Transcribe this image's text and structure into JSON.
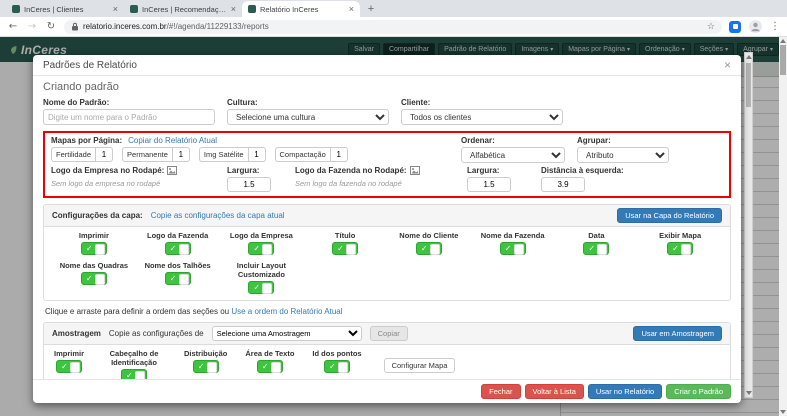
{
  "browser": {
    "tabs": [
      {
        "title": "InCeres | Clientes"
      },
      {
        "title": "InCeres | Recomendação"
      },
      {
        "title": "Relatório InCeres"
      }
    ],
    "url_domain": "relatorio.inceres.com.br",
    "url_path": "/#!/agenda/11229133/reports"
  },
  "app": {
    "logo": "InCeres",
    "nav": [
      {
        "label": "Salvar"
      },
      {
        "label": "Compartilhar"
      },
      {
        "label": "Padrão de Relatório"
      },
      {
        "label": "Imagens"
      },
      {
        "label": "Mapas por Página"
      },
      {
        "label": "Ordenação"
      },
      {
        "label": "Seções"
      },
      {
        "label": "Agrupar"
      }
    ]
  },
  "modal": {
    "title": "Padrões de Relatório",
    "heading": "Criando padrão",
    "form": {
      "nome_label": "Nome do Padrão:",
      "nome_placeholder": "Digite um nome para o Padrão",
      "cultura_label": "Cultura:",
      "cultura_value": "Selecione uma cultura",
      "cliente_label": "Cliente:",
      "cliente_value": "Todos os clientes"
    },
    "mapas": {
      "title": "Mapas por Página:",
      "copy_link": "Copiar do Relatório Atual",
      "fields": [
        {
          "label": "Fertilidade",
          "value": "1"
        },
        {
          "label": "Permanente",
          "value": "1"
        },
        {
          "label": "Img Satélite",
          "value": "1"
        },
        {
          "label": "Compactação",
          "value": "1"
        }
      ],
      "ordenar_label": "Ordenar:",
      "ordenar_value": "Alfabética",
      "agrupar_label": "Agrupar:",
      "agrupar_value": "Atributo",
      "logo_empresa_label": "Logo da Empresa no Rodapé:",
      "logo_empresa_placeholder": "Sem logo da empresa no rodapé",
      "largura_label_1": "Largura:",
      "largura_value_1": "1.5",
      "logo_fazenda_label": "Logo da Fazenda no Rodapé:",
      "logo_fazenda_placeholder": "Sem logo da fazenda no rodapé",
      "largura_label_2": "Largura:",
      "largura_value_2": "1.5",
      "distancia_label": "Distância à esquerda:",
      "distancia_value": "3.9"
    },
    "capa": {
      "title": "Configurações da capa:",
      "copy_link": "Copie as configurações da capa atual",
      "use_button": "Usar na Capa do Relatório",
      "toggles_row1": [
        "Imprimir",
        "Logo da Fazenda",
        "Logo da Empresa",
        "Título",
        "Nome do Cliente",
        "Nome da Fazenda",
        "Data",
        "Exibir Mapa"
      ],
      "toggles_row2": [
        "Nome das Quadras",
        "Nome dos Talhões",
        "Incluir Layout Customizado"
      ]
    },
    "order_hint_text": "Clique e arraste para definir a ordem das seções ou",
    "order_hint_link": "Use a ordem do Relatório Atual",
    "amostragem": {
      "title": "Amostragem",
      "copy_label": "Copie as configurações de",
      "select_value": "Selecione uma Amostragem",
      "copiar_button": "Copiar",
      "use_button": "Usar em Amostragem",
      "toggles": [
        "Imprimir",
        "Cabeçalho de Identificação",
        "Distribuição",
        "Área de Texto",
        "Id dos pontos"
      ],
      "configurar_button": "Configurar Mapa"
    },
    "footer": {
      "fechar": "Fechar",
      "voltar": "Voltar à Lista",
      "usar": "Usar no Relatório",
      "criar": "Criar o Padrão"
    }
  },
  "colors": {
    "header_teal": "#2a5c52",
    "accent_blue": "#337ab7",
    "danger_red": "#d9534f",
    "success_green": "#5cb85c",
    "toggle_green": "#3ec43e",
    "highlight_border": "#ee0000"
  }
}
